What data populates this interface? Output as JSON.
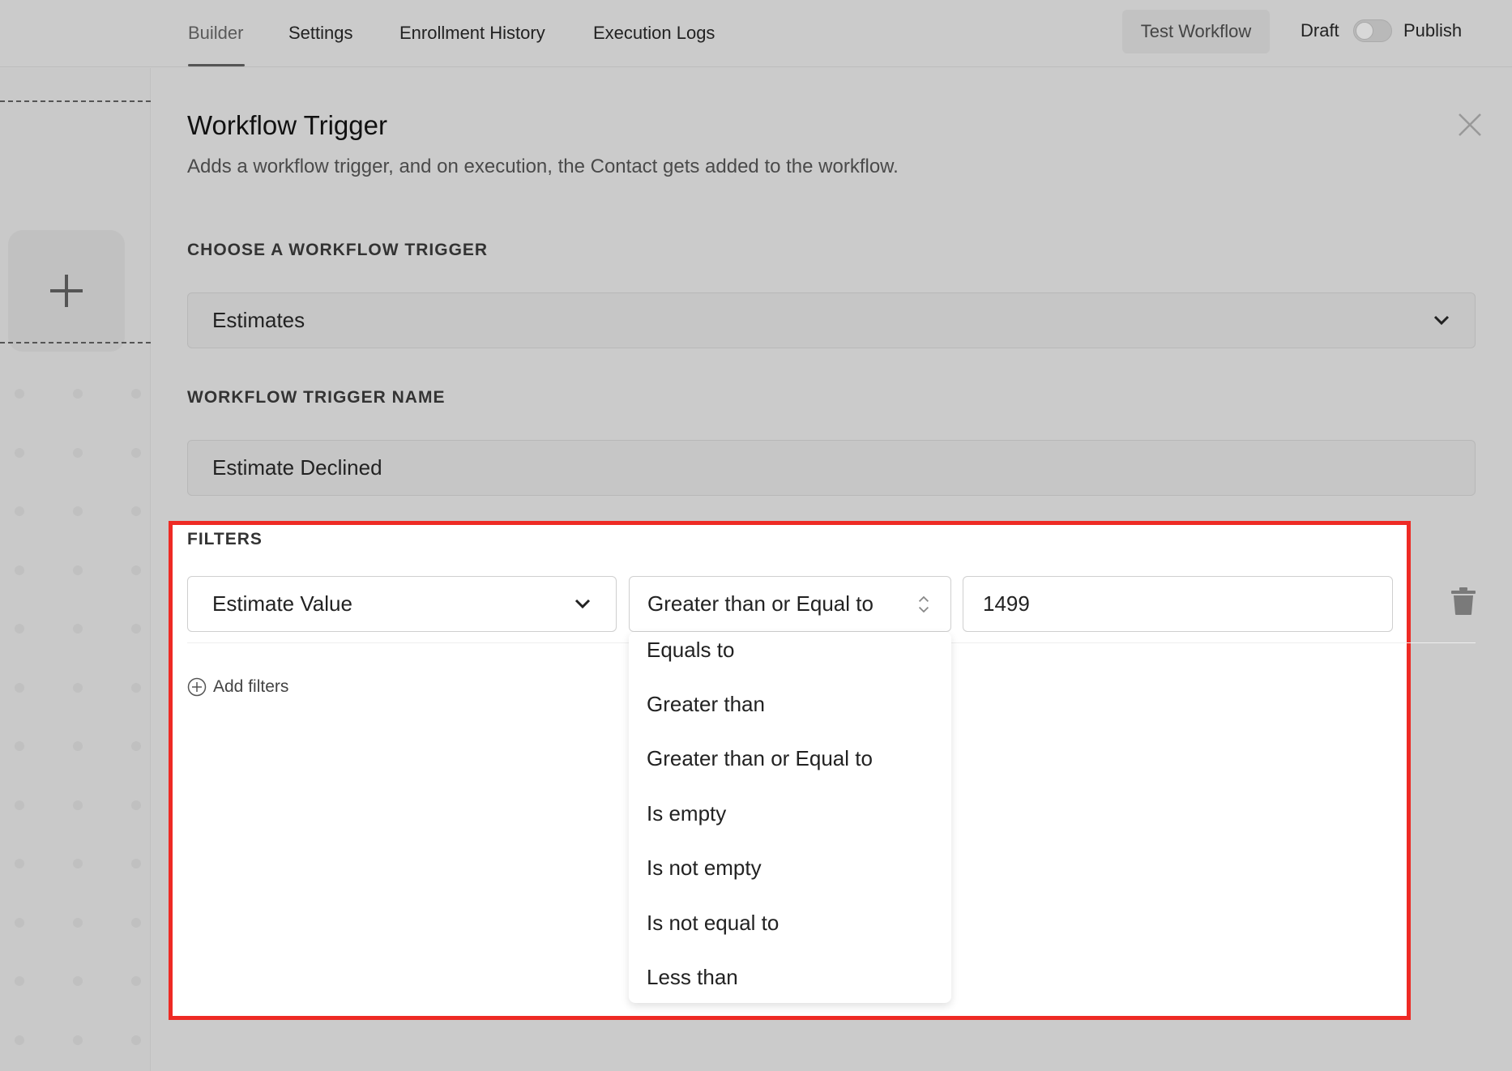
{
  "nav": {
    "tabs": [
      {
        "label": "Builder",
        "active": true
      },
      {
        "label": "Settings"
      },
      {
        "label": "Enrollment History"
      },
      {
        "label": "Execution Logs"
      }
    ],
    "test_button": "Test Workflow",
    "draft_label": "Draft",
    "publish_label": "Publish",
    "publish_toggle_on": false
  },
  "canvas": {
    "add_node_icon": "plus-icon"
  },
  "panel": {
    "title": "Workflow Trigger",
    "subtitle": "Adds a workflow trigger, and on execution, the Contact gets added to the workflow.",
    "close_icon": "close-icon",
    "trigger_section_label": "CHOOSE A WORKFLOW TRIGGER",
    "trigger_value": "Estimates",
    "trigger_name_label": "WORKFLOW TRIGGER NAME",
    "trigger_name_value": "Estimate Declined",
    "filters": {
      "label": "FILTERS",
      "field_value": "Estimate Value",
      "operator_value": "Greater than or Equal to",
      "value": "1499",
      "add_filters_label": "Add filters",
      "operator_options": [
        "Equals to",
        "Greater than",
        "Greater than or Equal to",
        "Is empty",
        "Is not empty",
        "Is not equal to",
        "Less than"
      ]
    }
  },
  "colors": {
    "highlight_border": "#ee2a24",
    "overlay_gray": "#cbcbcb"
  }
}
